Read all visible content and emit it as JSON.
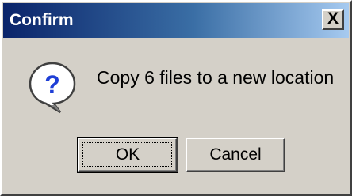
{
  "window": {
    "title": "Confirm",
    "close_glyph": "X",
    "title_colors": [
      "#0a246a",
      "#a6caf0"
    ]
  },
  "dialog": {
    "icon": "question-icon",
    "message": "Copy 6 files to a new location"
  },
  "buttons": {
    "ok_label": "OK",
    "cancel_label": "Cancel"
  }
}
